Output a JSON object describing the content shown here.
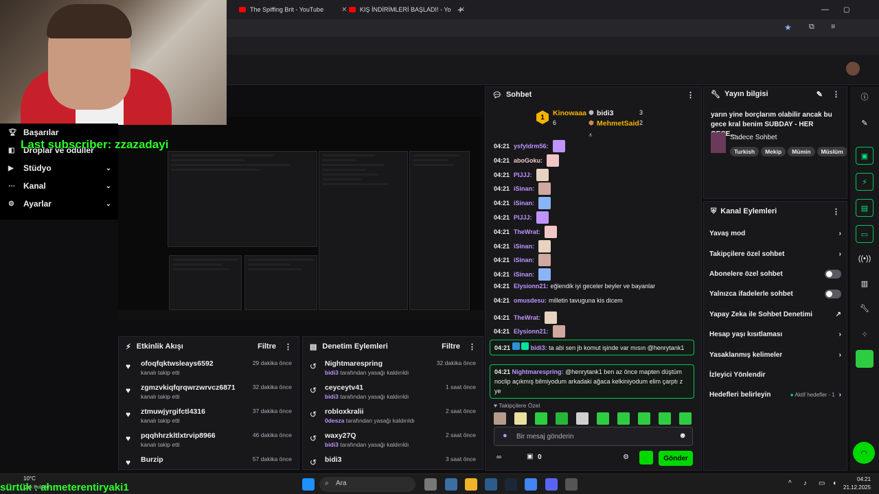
{
  "browser": {
    "tabs": [
      {
        "title": "The Spiffing Brit - YouTube"
      },
      {
        "title": "KIŞ İNDİRİMLERİ BAŞLADI! - Yo"
      }
    ],
    "new_tab": "+"
  },
  "overlay": {
    "last_subscriber": "Last subscriber: zzazadayi",
    "bottom_ticker": "sürtük : ahmeterentiryaki1"
  },
  "left_nav": {
    "items": [
      {
        "label": "Başarılar",
        "icon": "trophy-icon",
        "chevron": ""
      },
      {
        "label": "Droplar ve ödüller",
        "icon": "gift-icon",
        "chevron": ""
      },
      {
        "label": "Stüdyo",
        "icon": "video-icon",
        "chevron": "⌄"
      },
      {
        "label": "Kanal",
        "icon": "share-icon",
        "chevron": "⌄"
      },
      {
        "label": "Ayarlar",
        "icon": "gear-icon",
        "chevron": "⌄"
      }
    ]
  },
  "activity_feed": {
    "title": "Etkinlik Akışı",
    "filter": "Filtre",
    "items": [
      {
        "name": "ofoqfqktwsleays6592",
        "sub": "kanalı takip etti",
        "time": "29 dakika önce"
      },
      {
        "name": "zgmzvkiqfqrqwrzwrvcz6871",
        "sub": "kanalı takip etti",
        "time": "32 dakika önce"
      },
      {
        "name": "ztmuwjyrgifctl4316",
        "sub": "kanalı takip etti",
        "time": "37 dakika önce"
      },
      {
        "name": "pqqhhrzkltlxtrvip8966",
        "sub": "kanalı takip etti",
        "time": "46 dakika önce"
      },
      {
        "name": "Burzip",
        "sub": "",
        "time": "57 dakika önce"
      }
    ]
  },
  "mod_actions": {
    "title": "Denetim Eylemleri",
    "filter": "Filtre",
    "items": [
      {
        "name": "Nightmarespring",
        "by": "bidi3",
        "sub": "tarafından yasağı kaldırıldı",
        "time": "32 dakika önce"
      },
      {
        "name": "ceyceytv41",
        "by": "bidi3",
        "sub": "tarafından yasağı kaldırıldı",
        "time": "1 saat önce"
      },
      {
        "name": "robloxkralii",
        "by": "0desza",
        "sub": "tarafından yasağı kaldırıldı",
        "time": "2 saat önce"
      },
      {
        "name": "waxy27Q",
        "by": "bidi3",
        "sub": "tarafından yasağı kaldırıldı",
        "time": "2 saat önce"
      },
      {
        "name": "bidi3",
        "by": "",
        "sub": "",
        "time": "3 saat önce"
      }
    ]
  },
  "chat": {
    "title": "Sohbet",
    "leaderboard": {
      "first": {
        "rank": "1",
        "name": "Kinowaaa",
        "count": "6"
      },
      "second": {
        "name": "bidi3",
        "count": "3"
      },
      "third": {
        "name": "MehmetSaid",
        "count": "2"
      }
    },
    "messages": [
      {
        "time": "04:21",
        "user": "ysfyldrm56:",
        "text": "",
        "color": "#bf94ff"
      },
      {
        "time": "04:21",
        "user": "aboGoku:",
        "text": "",
        "color": "#f2c6c6"
      },
      {
        "time": "04:21",
        "user": "PIJJJ:",
        "text": "",
        "color": "#bf94ff"
      },
      {
        "time": "04:21",
        "user": "iSinan:",
        "text": "",
        "color": "#bf94ff"
      },
      {
        "time": "04:21",
        "user": "iSinan:",
        "text": "",
        "color": "#bf94ff"
      },
      {
        "time": "04:21",
        "user": "PIJJJ:",
        "text": "",
        "color": "#bf94ff"
      },
      {
        "time": "04:21",
        "user": "TheWrat:",
        "text": "",
        "color": "#bf94ff"
      },
      {
        "time": "04:21",
        "user": "iSinan:",
        "text": "",
        "color": "#bf94ff"
      },
      {
        "time": "04:21",
        "user": "iSinan:",
        "text": "",
        "color": "#bf94ff"
      },
      {
        "time": "04:21",
        "user": "iSinan:",
        "text": "",
        "color": "#bf94ff"
      },
      {
        "time": "04:21",
        "user": "Elysionn21:",
        "text": "eğlendik iyi geceler beyler ve bayanlar",
        "color": "#bf94ff"
      },
      {
        "time": "04:21",
        "user": "omusdesu:",
        "text": "milletin tavuguna kis dicem",
        "color": "#bf94ff"
      },
      {
        "time": "04:21",
        "user": "TheWrat:",
        "text": "",
        "color": "#bf94ff"
      },
      {
        "time": "04:21",
        "user": "Elysionn21:",
        "text": "",
        "color": "#bf94ff"
      }
    ],
    "highlight1": {
      "time": "04:21",
      "user": "bidi3:",
      "text": "ta abi sen jb komut işinde var mısın @henrytank1"
    },
    "highlight2": {
      "time": "04:21",
      "user": "Nightmarespring:",
      "text": "@henrytank1 ben az önce mapten düştüm noclip açıkmış bilmiyodum arkadaki ağaca kelkiniyodum elim çarptı z ye"
    },
    "followers_only": "Takipçilere Özel",
    "input_placeholder": "Bir mesaj gönderin",
    "points": "0",
    "send": "Gönder"
  },
  "stream_info": {
    "title": "Yayın bilgisi",
    "stream_title": "yarın yine borçlarım olabilir ancak bu gece kral benim SUBDAY - HER GECE...",
    "category": "Sadece Sohbet",
    "tags": [
      "Turkish",
      "Mekip",
      "Mümin",
      "Müslüm"
    ]
  },
  "channel_actions": {
    "title": "Kanal Eylemleri",
    "items": [
      {
        "label": "Yavaş mod",
        "control": "chevron"
      },
      {
        "label": "Takipçilere özel sohbet",
        "control": "chevron"
      },
      {
        "label": "Abonelere özel sohbet",
        "control": "toggle"
      },
      {
        "label": "Yalnızca ifadelerle sohbet",
        "control": "toggle"
      },
      {
        "label": "Yapay Zeka ile Sohbet Denetimi",
        "control": "external"
      },
      {
        "label": "Hesap yaşı kısıtlaması",
        "control": "chevron"
      },
      {
        "label": "Yasaklanmış kelimeler",
        "control": "chevron"
      },
      {
        "label": "İzleyici Yönlendir",
        "control": "none"
      },
      {
        "label": "Hedefleri belirleyin",
        "control": "chevron",
        "status": "Aktif hedefler - 1"
      }
    ]
  },
  "taskbar": {
    "weather": "10°C",
    "weather_sub": "Çok bulutlu",
    "search": "Ara",
    "time": "04:21",
    "date": "21.12.2025"
  }
}
